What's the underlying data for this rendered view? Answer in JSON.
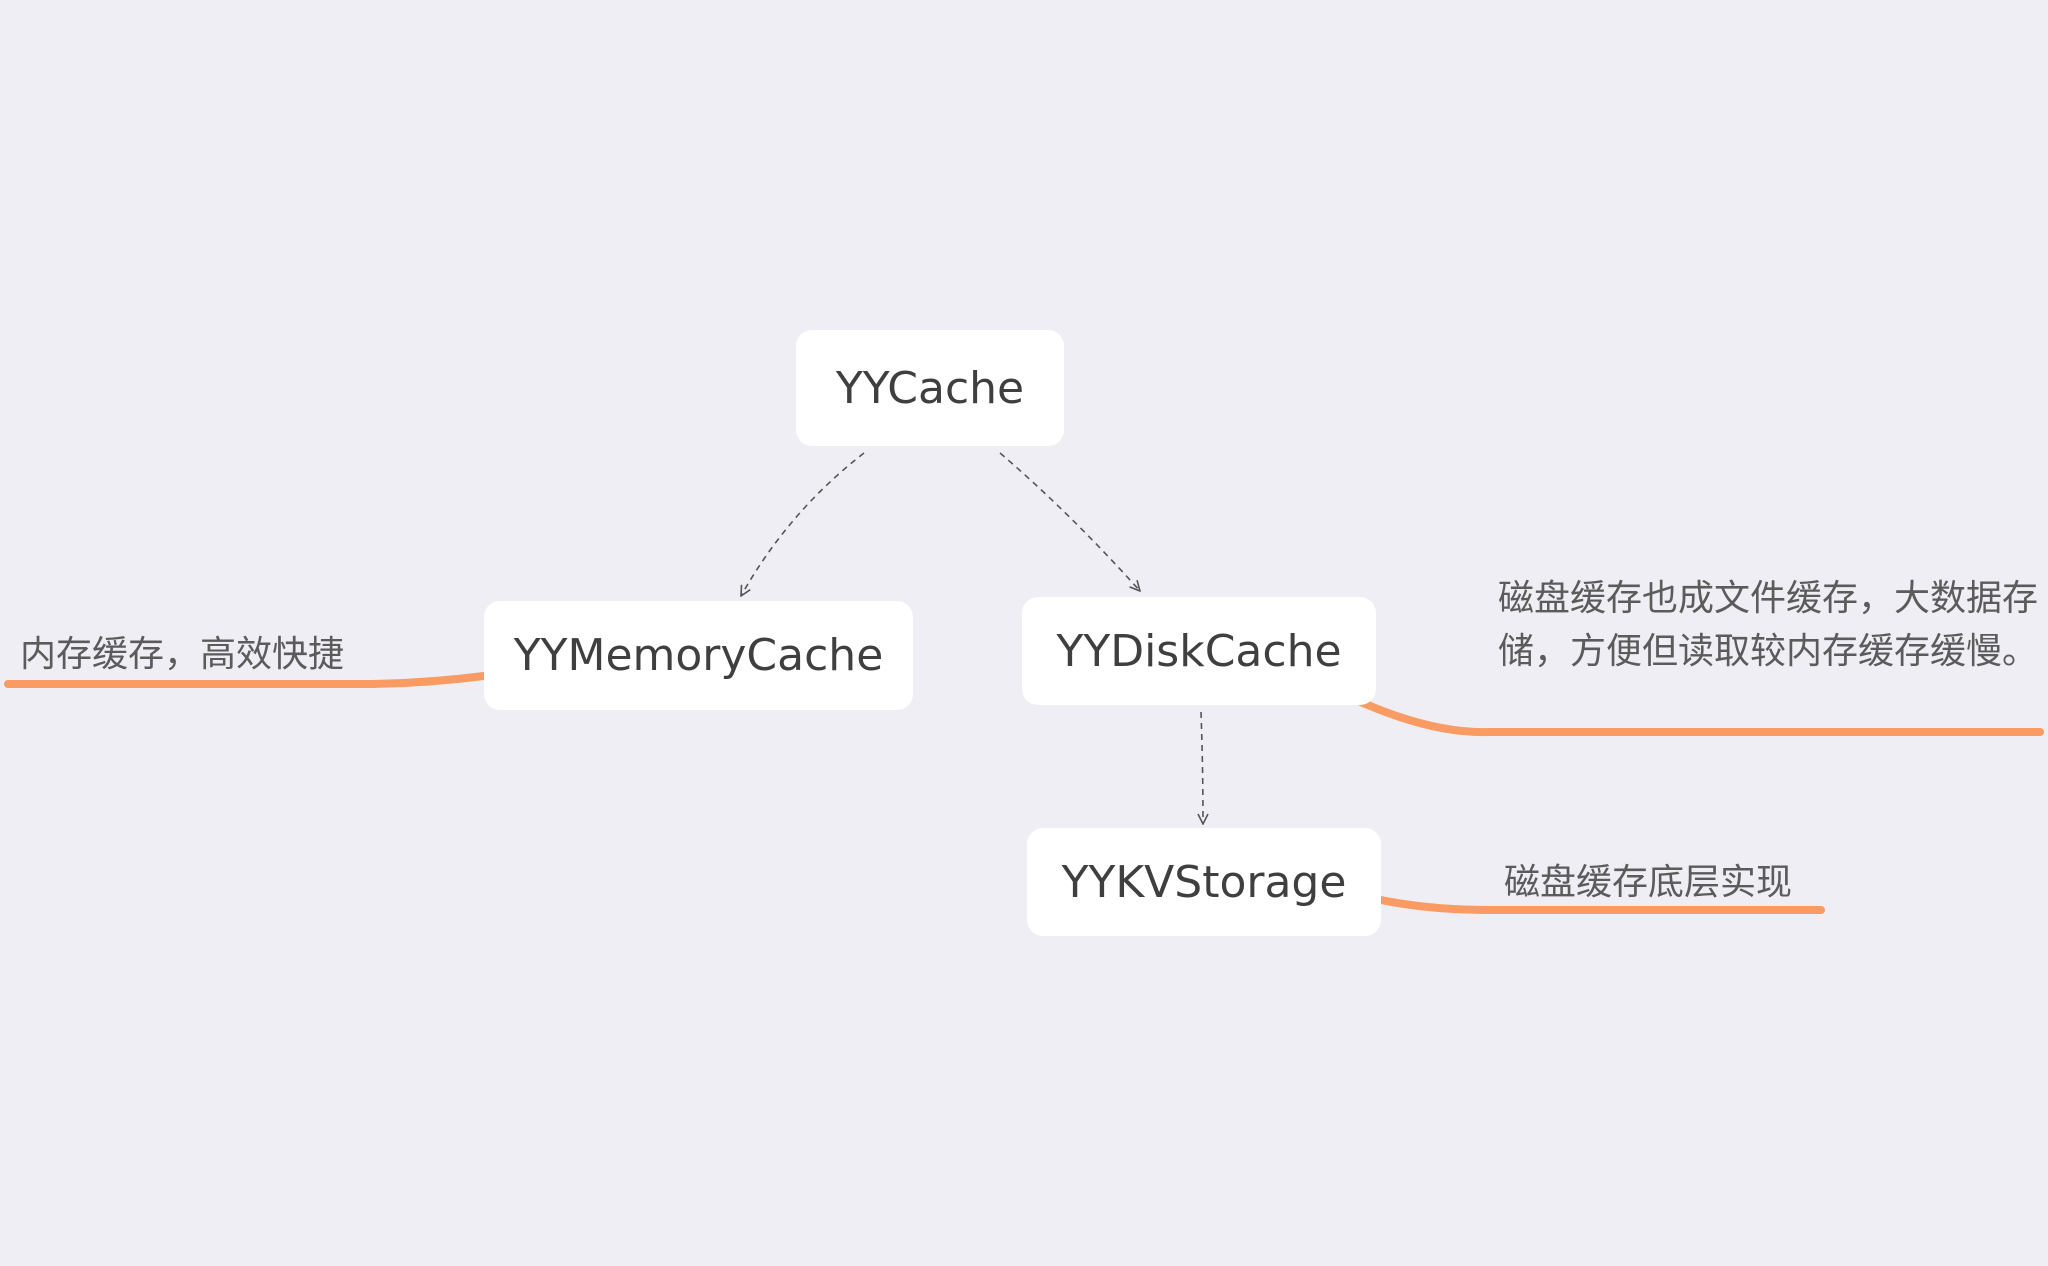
{
  "diagram": {
    "type": "mind-map",
    "nodes": {
      "root": {
        "label": "YYCache"
      },
      "memory": {
        "label": "YYMemoryCache"
      },
      "disk": {
        "label": "YYDiskCache"
      },
      "storage": {
        "label": "YYKVStorage"
      }
    },
    "notes": {
      "memory": "内存缓存，高效快捷",
      "disk": "磁盘缓存也成文件缓存，大数据存储，方便但读取较内存缓存缓慢。",
      "storage": "磁盘缓存底层实现"
    },
    "edges": [
      {
        "from": "YYCache",
        "to": "YYMemoryCache",
        "style": "dashed-arrow"
      },
      {
        "from": "YYCache",
        "to": "YYDiskCache",
        "style": "dashed-arrow"
      },
      {
        "from": "YYDiskCache",
        "to": "YYKVStorage",
        "style": "dashed-arrow"
      }
    ],
    "colors": {
      "background": "#efeef4",
      "node_fill": "#ffffff",
      "node_text": "#3f3f3f",
      "note_text": "#5b5b5b",
      "note_line": "#f99b62",
      "edge": "#555555"
    }
  }
}
